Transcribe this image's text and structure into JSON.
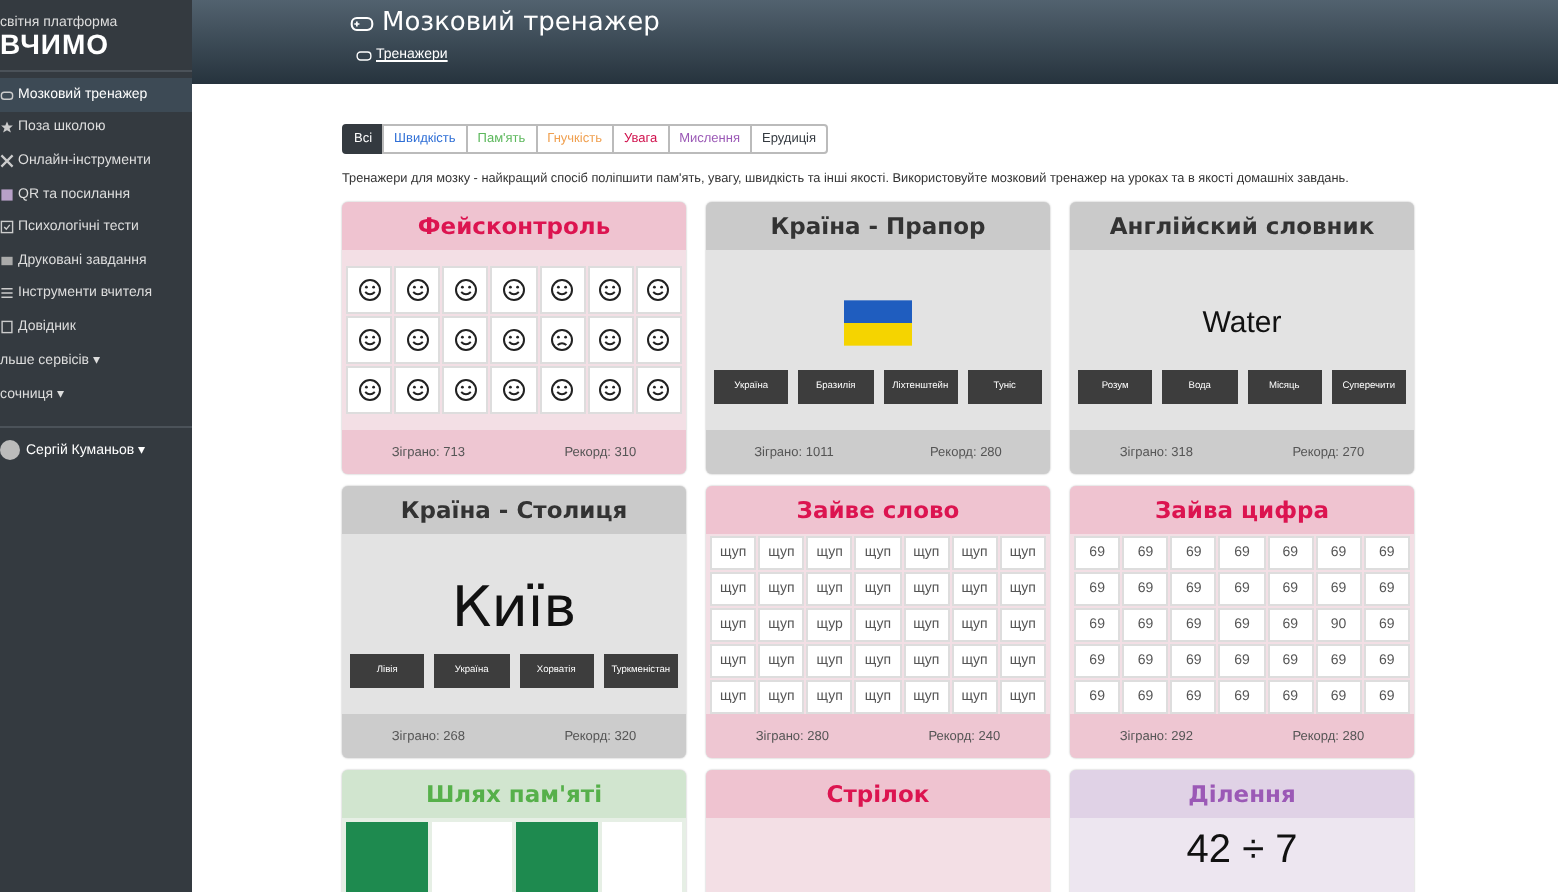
{
  "sidebar": {
    "platform": "світня платформа",
    "logo": "ВЧИМО",
    "items": [
      {
        "label": "Мозковий тренажер",
        "selected": true
      },
      {
        "label": "Поза школою",
        "selected": false
      },
      {
        "label": "Онлайн-інструменти",
        "selected": false
      },
      {
        "label": "QR та посилання",
        "selected": false
      },
      {
        "label": "Психологічні тести",
        "selected": false
      },
      {
        "label": "Друковані завдання",
        "selected": false
      },
      {
        "label": "Інструменти вчителя",
        "selected": false
      },
      {
        "label": "Довідник",
        "selected": false
      },
      {
        "label": "льше сервісів ▾",
        "selected": false
      },
      {
        "label": "сочниця ▾",
        "selected": false
      }
    ],
    "user": "Сергій Куманьов ▾"
  },
  "header": {
    "title": "Мозковий тренажер",
    "breadcrumb": "Тренажери"
  },
  "filters": [
    {
      "label": "Всі",
      "selected": true,
      "color": "#343a40"
    },
    {
      "label": "Швидкість",
      "selected": false,
      "color": "#2f6fd6"
    },
    {
      "label": "Пам'ять",
      "selected": false,
      "color": "#5cb85c"
    },
    {
      "label": "Гнучкість",
      "selected": false,
      "color": "#f0a050"
    },
    {
      "label": "Увага",
      "selected": false,
      "color": "#d0104c"
    },
    {
      "label": "Мислення",
      "selected": false,
      "color": "#9b59b6"
    },
    {
      "label": "Ерудиція",
      "selected": false,
      "color": "#343a40"
    }
  ],
  "description": "Тренажери для мозку - найкращий спосіб поліпшити пам'ять, увагу, швидкість та інші якості. Використовуйте мозковий тренажер на уроках та в якості домашніх завдань.",
  "cards": [
    {
      "title": "Фейсконтроль",
      "color": "#dc1450",
      "kind": "faces",
      "faces": [
        [
          {
            "sad": false
          },
          {
            "sad": false
          },
          {
            "sad": false
          },
          {
            "sad": false
          },
          {
            "sad": false
          },
          {
            "sad": false
          },
          {
            "sad": false
          }
        ],
        [
          {
            "sad": false
          },
          {
            "sad": false
          },
          {
            "sad": false
          },
          {
            "sad": false
          },
          {
            "sad": true
          },
          {
            "sad": false
          },
          {
            "sad": false
          }
        ],
        [
          {
            "sad": false
          },
          {
            "sad": false
          },
          {
            "sad": false
          },
          {
            "sad": false
          },
          {
            "sad": false
          },
          {
            "sad": false
          },
          {
            "sad": false
          }
        ]
      ],
      "played": "Зіграно: 713",
      "record": "Рекорд: 310"
    },
    {
      "title": "Країна - Прапор",
      "color": "#333333",
      "kind": "flag",
      "options": [
        "Україна",
        "Бразилія",
        "Ліхтенштейн",
        "Туніс"
      ],
      "played": "Зіграно: 1011",
      "record": "Рекорд: 280"
    },
    {
      "title": "Англійский словник",
      "color": "#333333",
      "kind": "word",
      "prompt": "Water",
      "options": [
        "Розум",
        "Вода",
        "Місяць",
        "Суперечити"
      ],
      "played": "Зіграно: 318",
      "record": "Рекорд: 270"
    },
    {
      "title": "Країна - Столиця",
      "color": "#333333",
      "kind": "word",
      "prompt": "Київ",
      "options": [
        "Лівія",
        "Україна",
        "Хорватія",
        "Туркменістан"
      ],
      "played": "Зіграно: 268",
      "record": "Рекорд: 320"
    },
    {
      "title": "Зайве слово",
      "color": "#dc1450",
      "kind": "text-grid",
      "grid": [
        [
          "щуп",
          "щуп",
          "щуп",
          "щуп",
          "щуп",
          "щуп",
          "щуп"
        ],
        [
          "щуп",
          "щуп",
          "щуп",
          "щуп",
          "щуп",
          "щуп",
          "щуп"
        ],
        [
          "щуп",
          "щуп",
          "щур",
          "щуп",
          "щуп",
          "щуп",
          "щуп"
        ],
        [
          "щуп",
          "щуп",
          "щуп",
          "щуп",
          "щуп",
          "щуп",
          "щуп"
        ],
        [
          "щуп",
          "щуп",
          "щуп",
          "щуп",
          "щуп",
          "щуп",
          "щуп"
        ]
      ],
      "played": "Зіграно: 280",
      "record": "Рекорд: 240"
    },
    {
      "title": "Зайва цифра",
      "color": "#dc1450",
      "kind": "text-grid",
      "grid": [
        [
          "69",
          "69",
          "69",
          "69",
          "69",
          "69",
          "69"
        ],
        [
          "69",
          "69",
          "69",
          "69",
          "69",
          "69",
          "69"
        ],
        [
          "69",
          "69",
          "69",
          "69",
          "69",
          "90",
          "69"
        ],
        [
          "69",
          "69",
          "69",
          "69",
          "69",
          "69",
          "69"
        ],
        [
          "69",
          "69",
          "69",
          "69",
          "69",
          "69",
          "69"
        ]
      ],
      "played": "Зіграно: 292",
      "record": "Рекорд: 280"
    },
    {
      "title": "Шлях пам'яті",
      "color": "#56b04a",
      "kind": "tiles",
      "tiles": [
        {
          "filled": true
        },
        {
          "filled": false
        },
        {
          "filled": true
        },
        {
          "filled": false
        }
      ]
    },
    {
      "title": "Стрілок",
      "color": "#dc1450",
      "kind": "blank"
    },
    {
      "title": "Ділення",
      "color": "#9b59b6",
      "kind": "expression",
      "prompt": "42 ÷ 7"
    }
  ]
}
